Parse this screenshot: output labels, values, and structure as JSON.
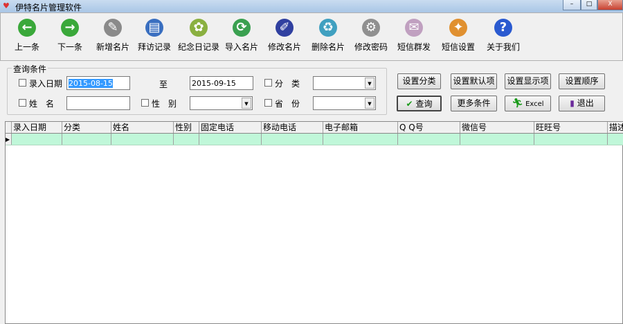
{
  "window": {
    "title": "伊特名片管理软件",
    "minimize": "–",
    "maximize": "□",
    "close": "X"
  },
  "toolbar": [
    {
      "label": "上一条",
      "icon": "arrow-left-icon",
      "glyph": "←",
      "color": "#3aa83a"
    },
    {
      "label": "下一条",
      "icon": "arrow-right-icon",
      "glyph": "→",
      "color": "#3aa83a"
    },
    {
      "label": "新增名片",
      "icon": "new-card-icon",
      "glyph": "✎",
      "color": "#8a8a8a"
    },
    {
      "label": "拜访记录",
      "icon": "visit-record-icon",
      "glyph": "▤",
      "color": "#3a6fc0"
    },
    {
      "label": "纪念日记录",
      "icon": "anniversary-icon",
      "glyph": "✿",
      "color": "#8ab040"
    },
    {
      "label": "导入名片",
      "icon": "import-icon",
      "glyph": "⟳",
      "color": "#3aa050"
    },
    {
      "label": "修改名片",
      "icon": "edit-card-icon",
      "glyph": "✐",
      "color": "#3040a0"
    },
    {
      "label": "删除名片",
      "icon": "recycle-bin-icon",
      "glyph": "♻",
      "color": "#40a0c0"
    },
    {
      "label": "修改密码",
      "icon": "gear-icon",
      "glyph": "⚙",
      "color": "#909090"
    },
    {
      "label": "短信群发",
      "icon": "envelope-icon",
      "glyph": "✉",
      "color": "#c0a0c0"
    },
    {
      "label": "短信设置",
      "icon": "sms-settings-icon",
      "glyph": "✦",
      "color": "#e09030"
    },
    {
      "label": "关于我们",
      "icon": "help-icon",
      "glyph": "?",
      "color": "#2a5ad0"
    }
  ],
  "query": {
    "title": "查询条件",
    "entry_date_label": "录入日期",
    "date_from": "2015-08-15",
    "to_label": "至",
    "date_to": "2015-09-15",
    "category_label": "分　类",
    "category_value": "",
    "name_label": "姓　名",
    "name_value": "",
    "gender_label": "性　别",
    "gender_value": "",
    "province_label": "省　份",
    "province_value": ""
  },
  "buttons": {
    "set_category": "设置分类",
    "set_default": "设置默认项",
    "set_display": "设置显示项",
    "set_order": "设置顺序",
    "search": "查询",
    "more": "更多条件",
    "excel": "Excel",
    "exit": "退出"
  },
  "table": {
    "columns": [
      "录入日期",
      "分类",
      "姓名",
      "性别",
      "固定电话",
      "移动电话",
      "电子邮箱",
      "Q Q号",
      "微信号",
      "旺旺号",
      "描述"
    ],
    "rows": [
      [
        "",
        "",
        "",
        "",
        "",
        "",
        "",
        "",
        "",
        "",
        ""
      ]
    ]
  }
}
